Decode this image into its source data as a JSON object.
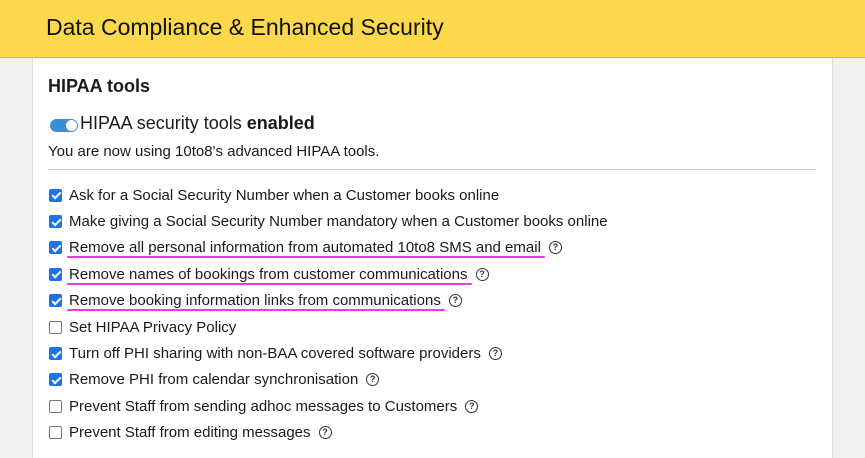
{
  "header": {
    "title": "Data Compliance & Enhanced Security"
  },
  "section": {
    "title": "HIPAA tools"
  },
  "toggle": {
    "enabled": true,
    "label_prefix": "HIPAA security tools",
    "label_state": "enabled",
    "description": "You are now using 10to8's advanced HIPAA tools.",
    "accent_color": "#3a8ed8"
  },
  "options": [
    {
      "label": "Ask for a Social Security Number when a Customer books online",
      "checked": true,
      "help": false,
      "highlighted": false
    },
    {
      "label": "Make giving a Social Security Number mandatory when a Customer books online",
      "checked": true,
      "help": false,
      "highlighted": false
    },
    {
      "label": "Remove all personal information from automated 10to8 SMS and email",
      "checked": true,
      "help": true,
      "highlighted": true
    },
    {
      "label": "Remove names of bookings from customer communications",
      "checked": true,
      "help": true,
      "highlighted": true
    },
    {
      "label": "Remove booking information links from communications",
      "checked": true,
      "help": true,
      "highlighted": true
    },
    {
      "label": "Set HIPAA Privacy Policy",
      "checked": false,
      "help": false,
      "highlighted": false
    },
    {
      "label": "Turn off PHI sharing with non-BAA covered software providers",
      "checked": true,
      "help": true,
      "highlighted": false
    },
    {
      "label": "Remove PHI from calendar synchronisation",
      "checked": true,
      "help": true,
      "highlighted": false
    },
    {
      "label": "Prevent Staff from sending adhoc messages to Customers",
      "checked": false,
      "help": true,
      "highlighted": false
    },
    {
      "label": "Prevent Staff from editing messages",
      "checked": false,
      "help": true,
      "highlighted": false
    }
  ],
  "colors": {
    "header_bg": "#fcd84c",
    "highlight": "#e83ce0",
    "checkbox": "#1a73e8"
  },
  "icons": {
    "help": "question-circle-icon",
    "toggle": "toggle-switch"
  },
  "help_glyph": "?"
}
